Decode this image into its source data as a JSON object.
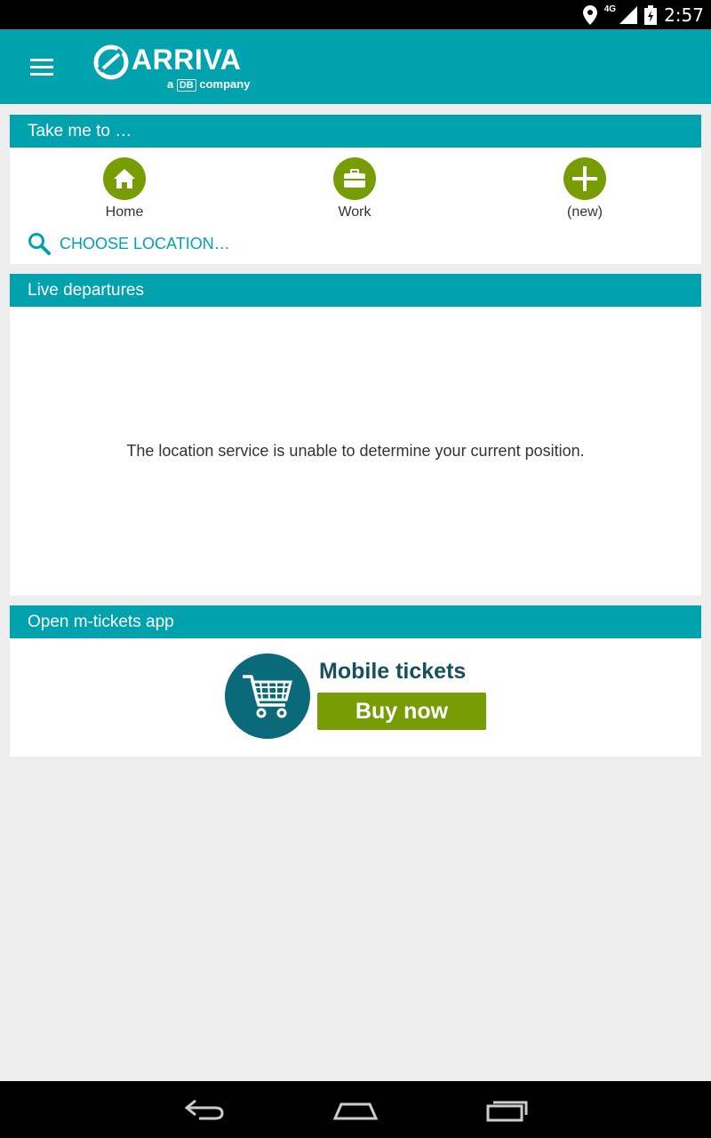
{
  "status_bar": {
    "time": "2:57",
    "network": "4G",
    "icons": [
      "location-icon",
      "signal-icon",
      "battery-icon"
    ]
  },
  "app_bar": {
    "brand": "ARRIVA",
    "tagline_prefix": "a",
    "tagline_box": "DB",
    "tagline_suffix": "company",
    "menu_icon": "menu-icon",
    "color": "#00a3ad"
  },
  "take_me_to": {
    "title": "Take me to …",
    "shortcuts": [
      {
        "label": "Home",
        "icon": "home-icon"
      },
      {
        "label": "Work",
        "icon": "briefcase-icon"
      },
      {
        "label": "(new)",
        "icon": "plus-icon"
      }
    ],
    "choose_location": "CHOOSE LOCATION…",
    "accent": "#789d04"
  },
  "live_departures": {
    "title": "Live departures",
    "message": "The location service is unable to determine your current position."
  },
  "m_tickets": {
    "title": "Open m-tickets app",
    "banner_title": "Mobile tickets",
    "banner_button": "Buy now"
  },
  "nav_bar": {
    "icons": [
      "back-icon",
      "home-nav-icon",
      "recents-icon"
    ]
  }
}
